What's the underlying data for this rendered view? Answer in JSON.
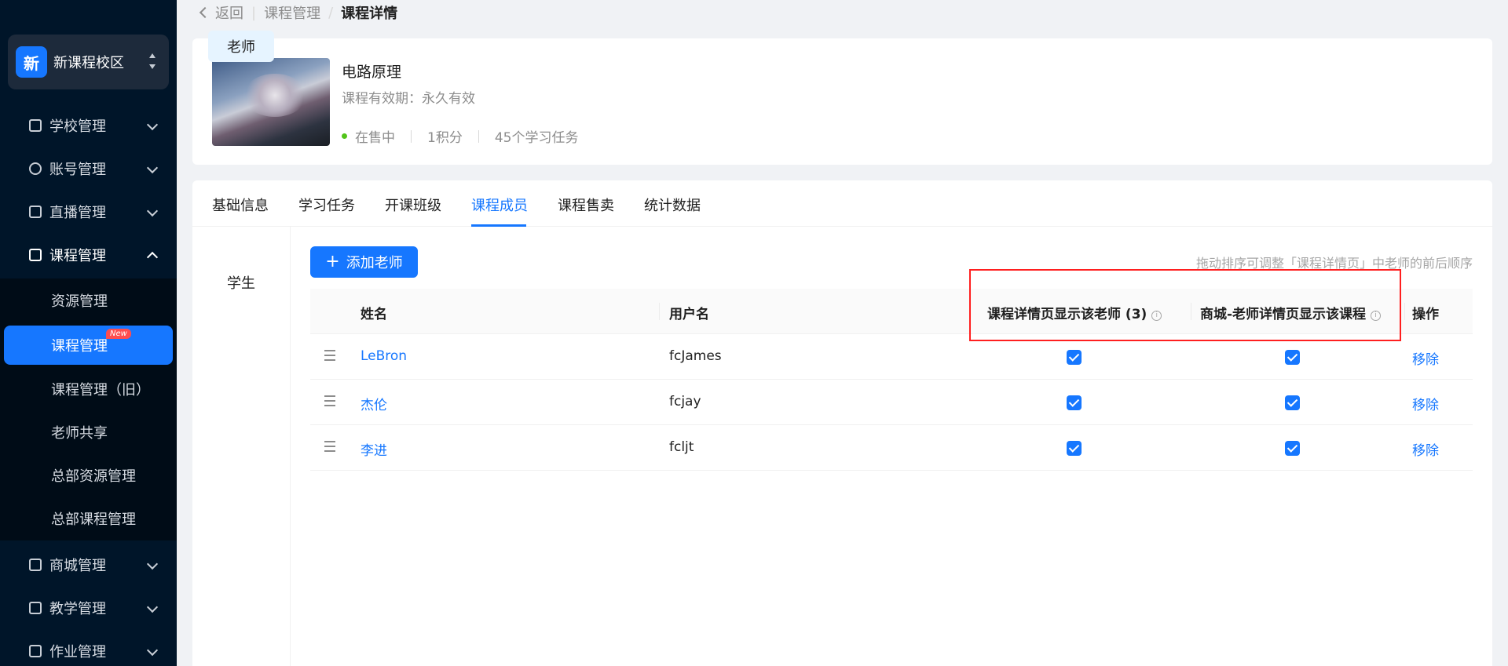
{
  "sidebar": {
    "campus": {
      "logo_text": "新",
      "name": "新课程校区"
    },
    "menu": [
      {
        "label": "学校管理",
        "icon": "school-icon"
      },
      {
        "label": "账号管理",
        "icon": "user-icon"
      },
      {
        "label": "直播管理",
        "icon": "tv-icon"
      },
      {
        "label": "课程管理",
        "icon": "book-icon",
        "expanded": true
      },
      {
        "label": "商城管理",
        "icon": "store-icon"
      },
      {
        "label": "教学管理",
        "icon": "notebook-icon"
      },
      {
        "label": "作业管理",
        "icon": "clipboard-icon"
      }
    ],
    "submenu": [
      {
        "label": "资源管理"
      },
      {
        "label": "课程管理",
        "active": true,
        "badge": "New"
      },
      {
        "label": "课程管理（旧）"
      },
      {
        "label": "老师共享"
      },
      {
        "label": "总部资源管理"
      },
      {
        "label": "总部课程管理"
      }
    ]
  },
  "breadcrumb": {
    "back": "返回",
    "parent": "课程管理",
    "separator": "/",
    "current": "课程详情"
  },
  "course": {
    "title": "电路原理",
    "validity": "课程有效期：永久有效",
    "status": "在售中",
    "points": "1积分",
    "tasks": "45个学习任务"
  },
  "tabs": [
    "基础信息",
    "学习任务",
    "开课班级",
    "课程成员",
    "课程售卖",
    "统计数据"
  ],
  "active_tab": "课程成员",
  "roles": [
    "老师",
    "学生"
  ],
  "active_role": "老师",
  "add_button": "添加老师",
  "hint": "拖动排序可调整「课程详情页」中老师的前后顺序",
  "table": {
    "headers": {
      "name": "姓名",
      "username": "用户名",
      "show_on_detail": "课程详情页显示该老师 (3)",
      "show_in_mall": "商城-老师详情页显示该课程",
      "action": "操作"
    },
    "rows": [
      {
        "name": "LeBron",
        "username": "fcJames",
        "show_on_detail": true,
        "show_in_mall": true,
        "action": "移除"
      },
      {
        "name": "杰伦",
        "username": "fcjay",
        "show_on_detail": true,
        "show_in_mall": true,
        "action": "移除"
      },
      {
        "name": "李进",
        "username": "fcljt",
        "show_on_detail": true,
        "show_in_mall": true,
        "action": "移除"
      }
    ]
  },
  "colors": {
    "sidebar_bg": "#001529",
    "primary": "#1677ff",
    "highlight_border": "#ff1f1f",
    "status_dot": "#52c41a"
  }
}
